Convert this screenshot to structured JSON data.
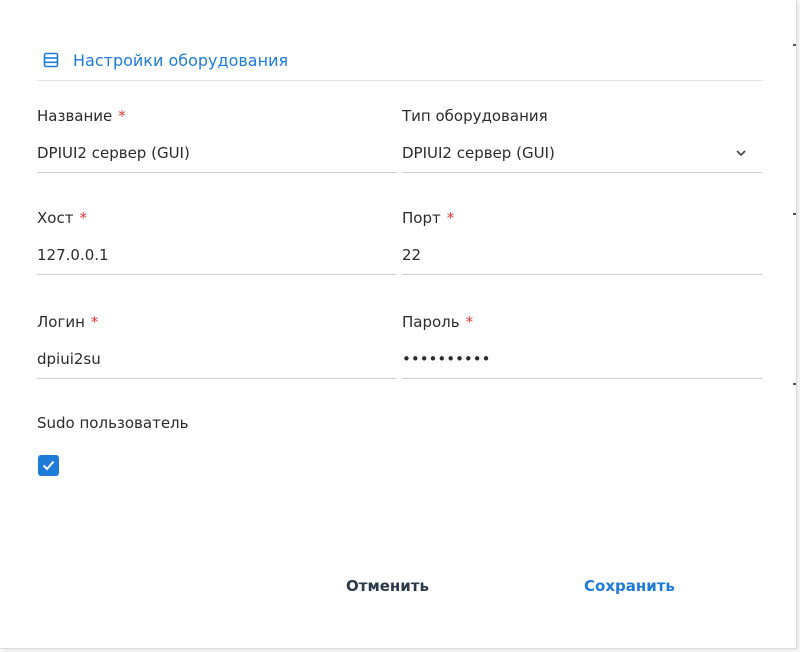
{
  "header": {
    "title": "Настройки оборудования",
    "icon": "server-list-icon"
  },
  "form": {
    "name": {
      "label": "Название",
      "required": "*",
      "value": "DPIUI2 сервер (GUI)"
    },
    "equipment_type": {
      "label": "Тип оборудования",
      "value": "DPIUI2 сервер (GUI)",
      "icon": "chevron-down-icon"
    },
    "host": {
      "label": "Хост",
      "required": "*",
      "value": "127.0.0.1"
    },
    "port": {
      "label": "Порт",
      "required": "*",
      "value": "22"
    },
    "login": {
      "label": "Логин",
      "required": "*",
      "value": "dpiui2su"
    },
    "password": {
      "label": "Пароль",
      "required": "*",
      "value": "••••••••••"
    },
    "sudo": {
      "label": "Sudo пользователь",
      "checked": true
    }
  },
  "actions": {
    "cancel": "Отменить",
    "save": "Сохранить"
  },
  "colors": {
    "accent": "#1e7bd8",
    "required": "#e53935",
    "text": "#2b2b2b"
  }
}
